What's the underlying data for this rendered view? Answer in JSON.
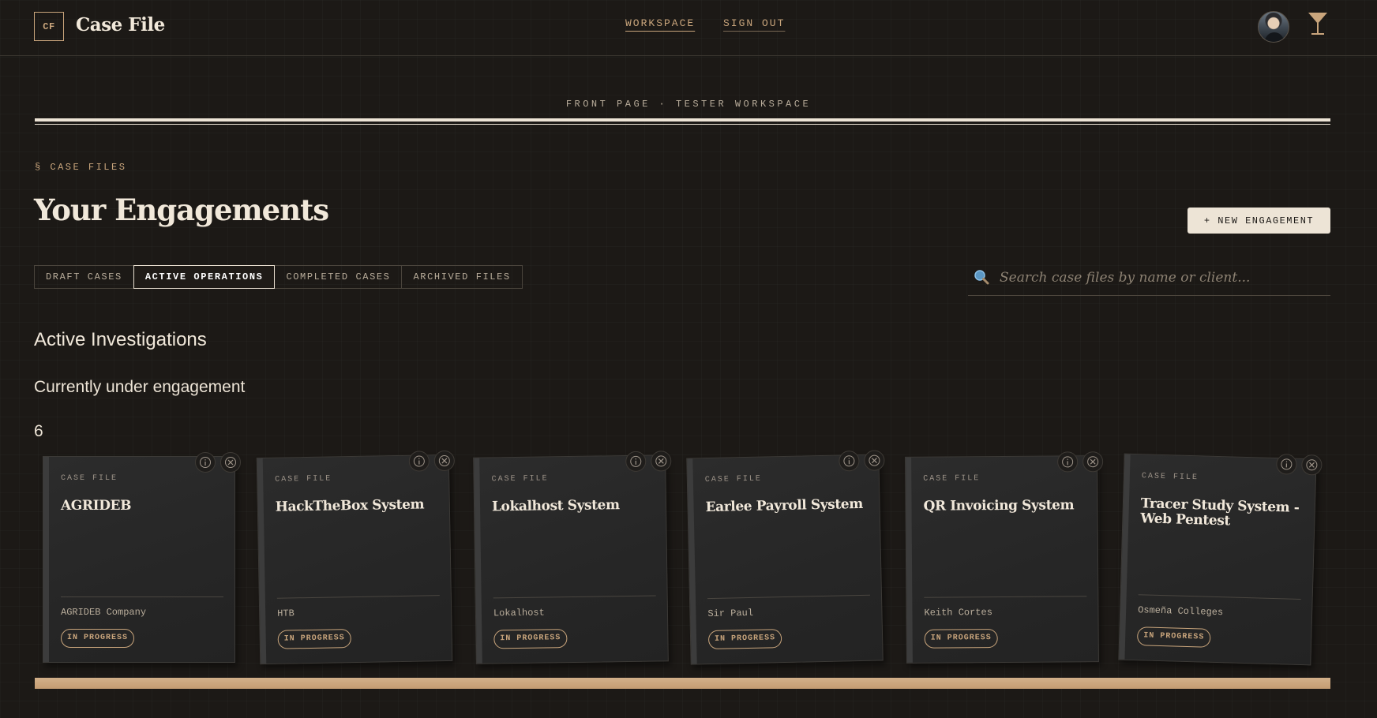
{
  "brand": {
    "logo_text": "CF",
    "title": "Case File"
  },
  "nav": {
    "workspace": "WORKSPACE",
    "sign_out": "SIGN OUT"
  },
  "header_label": "FRONT PAGE · TESTER WORKSPACE",
  "section_label": "§ CASE FILES",
  "page_title": "Your Engagements",
  "new_button": "+ NEW ENGAGEMENT",
  "tabs": [
    {
      "label": "DRAFT CASES",
      "active": false
    },
    {
      "label": "ACTIVE OPERATIONS",
      "active": true
    },
    {
      "label": "COMPLETED CASES",
      "active": false
    },
    {
      "label": "ARCHIVED FILES",
      "active": false
    }
  ],
  "search": {
    "placeholder": "Search case files by name or client...",
    "value": ""
  },
  "list": {
    "heading": "Active Investigations",
    "description": "Currently under engagement",
    "count": "6"
  },
  "cards": [
    {
      "label": "CASE FILE",
      "title": "AGRIDEB",
      "client": "AGRIDEB Company",
      "status": "IN PROGRESS"
    },
    {
      "label": "CASE FILE",
      "title": "HackTheBox System",
      "client": "HTB",
      "status": "IN PROGRESS"
    },
    {
      "label": "CASE FILE",
      "title": "Lokalhost System",
      "client": "Lokalhost",
      "status": "IN PROGRESS"
    },
    {
      "label": "CASE FILE",
      "title": "Earlee Payroll System",
      "client": "Sir Paul",
      "status": "IN PROGRESS"
    },
    {
      "label": "CASE FILE",
      "title": "QR Invoicing System",
      "client": "Keith Cortes",
      "status": "IN PROGRESS"
    },
    {
      "label": "CASE FILE",
      "title": "Tracer Study System - Web Pentest",
      "client": "Osmeña Colleges",
      "status": "IN PROGRESS"
    }
  ],
  "icons": {
    "search": "search-icon",
    "info": "info-icon",
    "close": "close-circle-icon",
    "brand_mark": "martini-glass-icon"
  },
  "colors": {
    "background": "#1c1916",
    "accent": "#c9a57c",
    "text": "#ede4d6",
    "card": "#2a2a2a"
  }
}
